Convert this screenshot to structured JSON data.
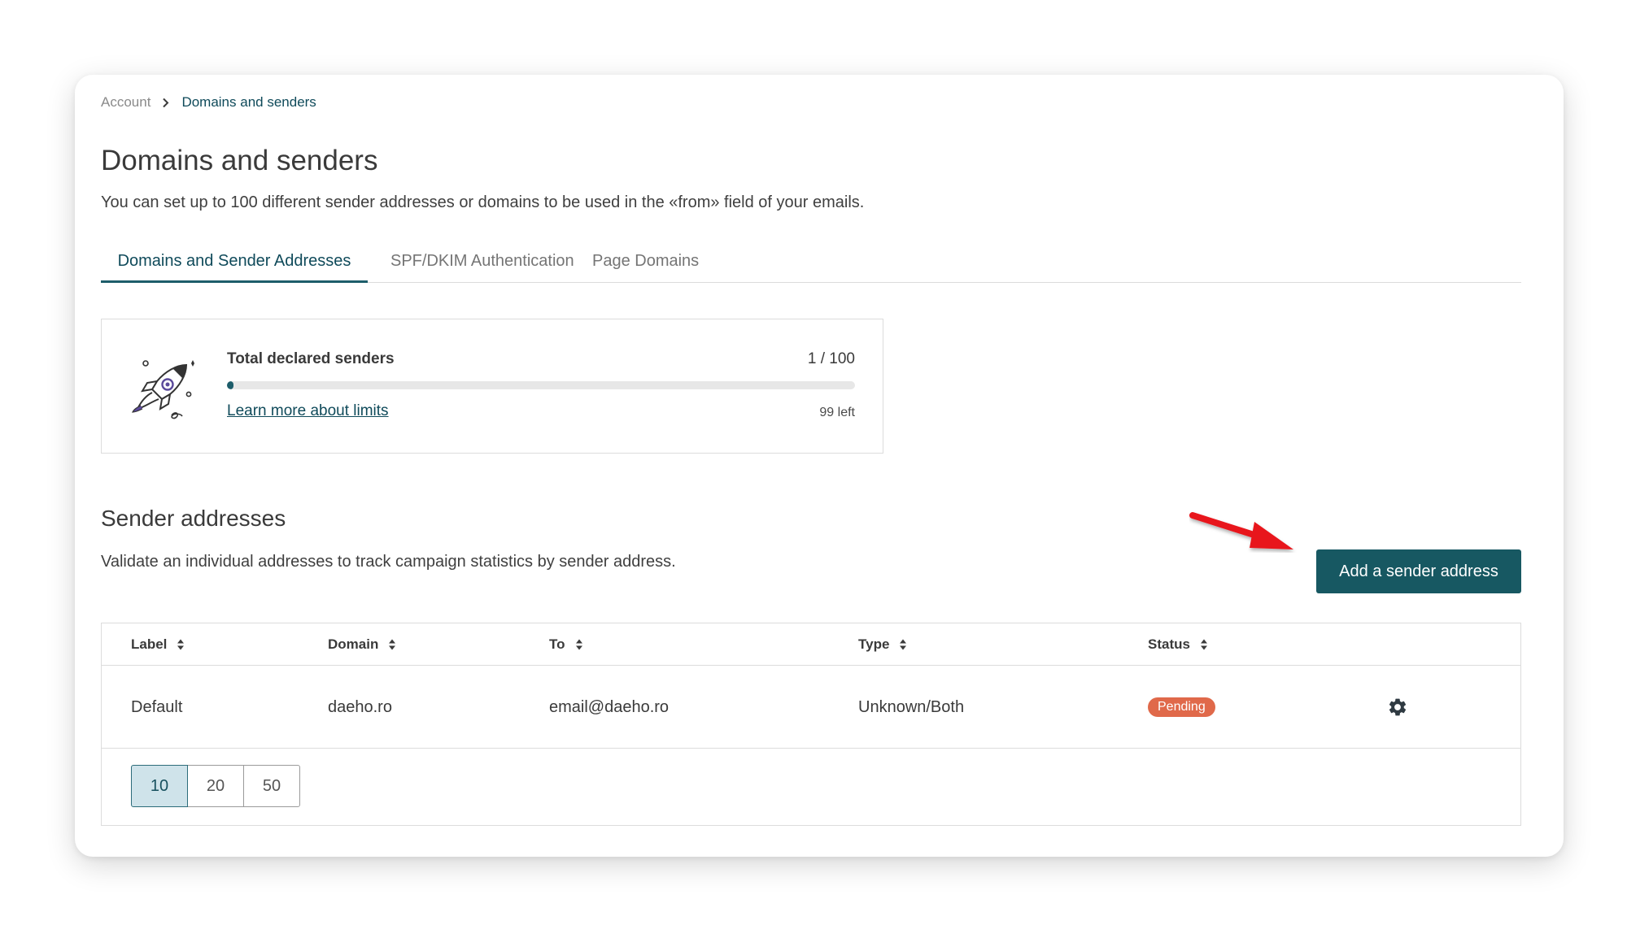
{
  "breadcrumb": {
    "parent": "Account",
    "current": "Domains and senders"
  },
  "page": {
    "title": "Domains and senders",
    "description": "You can set up to 100 different sender addresses or domains to be used in the «from» field of your emails."
  },
  "tabs": [
    {
      "label": "Domains and Sender Addresses",
      "active": true
    },
    {
      "label": "SPF/DKIM Authentication",
      "active": false
    },
    {
      "label": "Page Domains",
      "active": false
    }
  ],
  "limits": {
    "label": "Total declared senders",
    "count": "1 / 100",
    "progress_fraction": 0.01,
    "link": "Learn more about limits",
    "remaining": "99 left"
  },
  "senders": {
    "title": "Sender addresses",
    "description": "Validate an individual addresses to track campaign statistics by sender address.",
    "add_button": "Add a sender address"
  },
  "table": {
    "columns": [
      "Label",
      "Domain",
      "To",
      "Type",
      "Status"
    ],
    "rows": [
      {
        "label": "Default",
        "domain": "daeho.ro",
        "to": "email@daeho.ro",
        "type": "Unknown/Both",
        "status": "Pending"
      }
    ]
  },
  "pagination": {
    "options": [
      "10",
      "20",
      "50"
    ],
    "selected": "10"
  },
  "colors": {
    "accent": "#175862",
    "status_pending": "#e0694a",
    "annotation_arrow": "#e8141b"
  }
}
